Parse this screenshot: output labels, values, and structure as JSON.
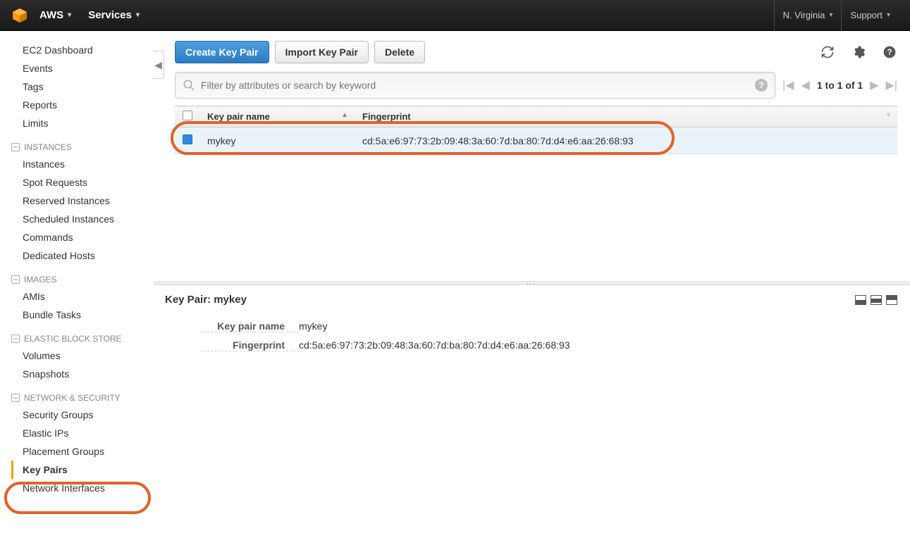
{
  "topnav": {
    "brand": "AWS",
    "services": "Services",
    "region": "N. Virginia",
    "support": "Support"
  },
  "sidebar": {
    "top": [
      "EC2 Dashboard",
      "Events",
      "Tags",
      "Reports",
      "Limits"
    ],
    "sections": [
      {
        "title": "INSTANCES",
        "items": [
          "Instances",
          "Spot Requests",
          "Reserved Instances",
          "Scheduled Instances",
          "Commands",
          "Dedicated Hosts"
        ]
      },
      {
        "title": "IMAGES",
        "items": [
          "AMIs",
          "Bundle Tasks"
        ]
      },
      {
        "title": "ELASTIC BLOCK STORE",
        "items": [
          "Volumes",
          "Snapshots"
        ]
      },
      {
        "title": "NETWORK & SECURITY",
        "items": [
          "Security Groups",
          "Elastic IPs",
          "Placement Groups",
          "Key Pairs",
          "Network Interfaces"
        ],
        "active": "Key Pairs"
      }
    ]
  },
  "toolbar": {
    "create": "Create Key Pair",
    "import": "Import Key Pair",
    "delete": "Delete"
  },
  "search": {
    "placeholder": "Filter by attributes or search by keyword"
  },
  "pager": {
    "text": "1 to 1 of 1"
  },
  "table": {
    "columns": [
      "Key pair name",
      "Fingerprint"
    ],
    "rows": [
      {
        "name": "mykey",
        "fingerprint": "cd:5a:e6:97:73:2b:09:48:3a:60:7d:ba:80:7d:d4:e6:aa:26:68:93"
      }
    ]
  },
  "detail": {
    "title_prefix": "Key Pair:",
    "title_value": "mykey",
    "labels": {
      "name": "Key pair name",
      "fingerprint": "Fingerprint"
    },
    "values": {
      "name": "mykey",
      "fingerprint": "cd:5a:e6:97:73:2b:09:48:3a:60:7d:ba:80:7d:d4:e6:aa:26:68:93"
    }
  }
}
